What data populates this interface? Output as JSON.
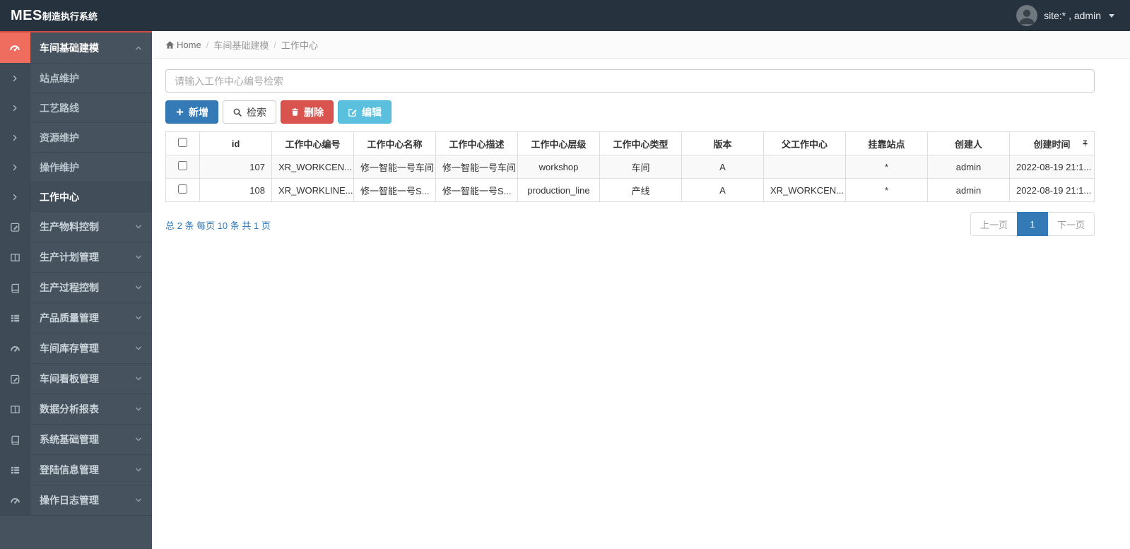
{
  "navbar": {
    "brand_mes": "MES",
    "brand_rest": "制造执行系统",
    "user_label": "site:* , admin"
  },
  "breadcrumb": {
    "home": "Home",
    "section": "车间基础建模",
    "current": "工作中心"
  },
  "sidebar": {
    "active_parent": {
      "label": "车间基础建模",
      "icon": "dashboard-icon",
      "state": "expanded",
      "accent_color": "#ef6d5e"
    },
    "submenu": {
      "items": [
        {
          "label": "站点维护",
          "active": false
        },
        {
          "label": "工艺路线",
          "active": false
        },
        {
          "label": "资源维护",
          "active": false
        },
        {
          "label": "操作维护",
          "active": false
        },
        {
          "label": "工作中心",
          "active": true
        }
      ]
    },
    "items": [
      {
        "label": "生产物料控制",
        "icon": "pencil-square-icon",
        "accent": "#f0ad4e"
      },
      {
        "label": "生产计划管理",
        "icon": "columns-icon",
        "accent": "#39c0ba"
      },
      {
        "label": "生产过程控制",
        "icon": "book-icon",
        "accent": "#39a9c9"
      },
      {
        "label": "产品质量管理",
        "icon": "list-icon",
        "accent": "#5cb85c"
      },
      {
        "label": "车间库存管理",
        "icon": "dashboard-icon",
        "accent": "#d9534f"
      },
      {
        "label": "车间看板管理",
        "icon": "pencil-square-icon",
        "accent": "#f0ad4e"
      },
      {
        "label": "数据分析报表",
        "icon": "columns-icon",
        "accent": "#5cb85c"
      },
      {
        "label": "系统基础管理",
        "icon": "book-icon",
        "accent": "#4a90d9"
      },
      {
        "label": "登陆信息管理",
        "icon": "list-icon",
        "accent": "#39c0ba"
      },
      {
        "label": "操作日志管理",
        "icon": "dashboard-icon",
        "accent": "#d9534f"
      }
    ]
  },
  "toolbar": {
    "search_placeholder": "请输入工作中心编号检索",
    "search_value": "",
    "add_label": "新增",
    "query_label": "检索",
    "delete_label": "删除",
    "edit_label": "编辑"
  },
  "table": {
    "headers": [
      "id",
      "工作中心编号",
      "工作中心名称",
      "工作中心描述",
      "工作中心层级",
      "工作中心类型",
      "版本",
      "父工作中心",
      "挂靠站点",
      "创建人",
      "创建时间"
    ],
    "rows": [
      {
        "cells": [
          "107",
          "XR_WORKCEN...",
          "修一智能一号车间",
          "修一智能一号车间",
          "workshop",
          "车间",
          "A",
          "",
          "*",
          "admin",
          "2022-08-19 21:1..."
        ]
      },
      {
        "cells": [
          "108",
          "XR_WORKLINE...",
          "修一智能一号S...",
          "修一智能一号S...",
          "production_line",
          "产线",
          "A",
          "XR_WORKCEN...",
          "*",
          "admin",
          "2022-08-19 21:1..."
        ]
      }
    ]
  },
  "pagination": {
    "summary": "总 2 条 每页 10 条 共 1 页",
    "prev": "上一页",
    "current": "1",
    "next": "下一页"
  },
  "colors": {
    "navbar_bg": "#27323f",
    "sidebar_bg": "#46535f",
    "primary": "#337ab7",
    "danger": "#d9534f",
    "info": "#5bc0de",
    "active_icon_bg": "#ef6d5e"
  }
}
